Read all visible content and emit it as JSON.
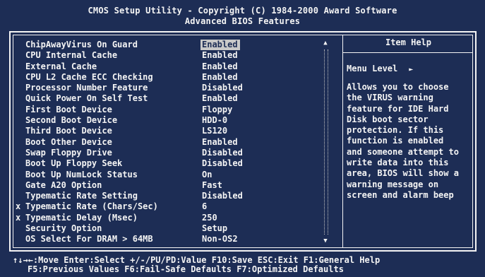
{
  "title": {
    "line1": "CMOS Setup Utility - Copyright (C) 1984-2000 Award Software",
    "line2": "Advanced BIOS Features"
  },
  "items": [
    {
      "label": "ChipAwayVirus On Guard",
      "value": "Enabled",
      "selected": true,
      "locked": false
    },
    {
      "label": "CPU Internal Cache",
      "value": "Enabled",
      "selected": false,
      "locked": false
    },
    {
      "label": "External Cache",
      "value": "Enabled",
      "selected": false,
      "locked": false
    },
    {
      "label": "CPU L2 Cache ECC Checking",
      "value": "Enabled",
      "selected": false,
      "locked": false
    },
    {
      "label": "Processor Number Feature",
      "value": "Disabled",
      "selected": false,
      "locked": false
    },
    {
      "label": "Quick Power On Self Test",
      "value": "Enabled",
      "selected": false,
      "locked": false
    },
    {
      "label": "First Boot Device",
      "value": "Floppy",
      "selected": false,
      "locked": false
    },
    {
      "label": "Second Boot Device",
      "value": "HDD-0",
      "selected": false,
      "locked": false
    },
    {
      "label": "Third Boot Device",
      "value": "LS120",
      "selected": false,
      "locked": false
    },
    {
      "label": "Boot Other Device",
      "value": "Enabled",
      "selected": false,
      "locked": false
    },
    {
      "label": "Swap Floppy Drive",
      "value": "Disabled",
      "selected": false,
      "locked": false
    },
    {
      "label": "Boot Up Floppy Seek",
      "value": "Disabled",
      "selected": false,
      "locked": false
    },
    {
      "label": "Boot Up NumLock Status",
      "value": "On",
      "selected": false,
      "locked": false
    },
    {
      "label": "Gate A20 Option",
      "value": "Fast",
      "selected": false,
      "locked": false
    },
    {
      "label": "Typematic Rate Setting",
      "value": "Disabled",
      "selected": false,
      "locked": false
    },
    {
      "label": "Typematic Rate (Chars/Sec)",
      "value": "6",
      "selected": false,
      "locked": true
    },
    {
      "label": "Typematic Delay (Msec)",
      "value": "250",
      "selected": false,
      "locked": true
    },
    {
      "label": "Security Option",
      "value": "Setup",
      "selected": false,
      "locked": false
    },
    {
      "label": "OS Select For DRAM > 64MB",
      "value": "Non-OS2",
      "selected": false,
      "locked": false
    }
  ],
  "lock_marker": "x",
  "scrollbar": {
    "up": "▲",
    "down": "▼"
  },
  "help": {
    "title": "Item Help",
    "menu_level_label": "Menu Level",
    "menu_level_arrow": "►",
    "lines": [
      "Allows you to choose",
      "the VIRUS warning",
      "feature for IDE Hard",
      "Disk boot sector",
      "protection. If this",
      "function is enabled",
      "and someone attempt to",
      "write data into this",
      "area, BIOS will show a",
      "warning message on",
      "screen and alarm beep"
    ]
  },
  "footer": {
    "line1": "↑↓→←:Move  Enter:Select  +/-/PU/PD:Value  F10:Save  ESC:Exit  F1:General Help",
    "line2": "F5:Previous Values    F6:Fail-Safe Defaults    F7:Optimized Defaults"
  }
}
